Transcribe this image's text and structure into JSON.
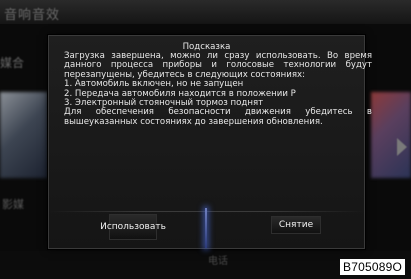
{
  "background": {
    "header_text": "音响音效",
    "left_label": "媒合",
    "left_bottom_text": "影媒",
    "bottom_text": "电话"
  },
  "dialog": {
    "title": "Подсказка",
    "paragraph1": "Загрузка завершена, можно ли сразу использовать. Во время данного процесса приборы и голосовые технологии будут перезапущены, убедитесь в следующих состояниях:",
    "item1": "1. Автомобиль включен, но не запущен",
    "item2": "2. Передача автомобиля находится в положении P",
    "item3": "3. Электронный стояночный тормоз поднят",
    "paragraph2": "Для обеспечения безопасности движения убедитесь в вышеуказанных состояниях до завершения обновления.",
    "use_button_label": "Использовать",
    "cancel_button_label": "Снятие"
  },
  "figure_code": "B705089O",
  "colors": {
    "accent_glow": "#4a64c8",
    "text": "#e8e8e8"
  }
}
